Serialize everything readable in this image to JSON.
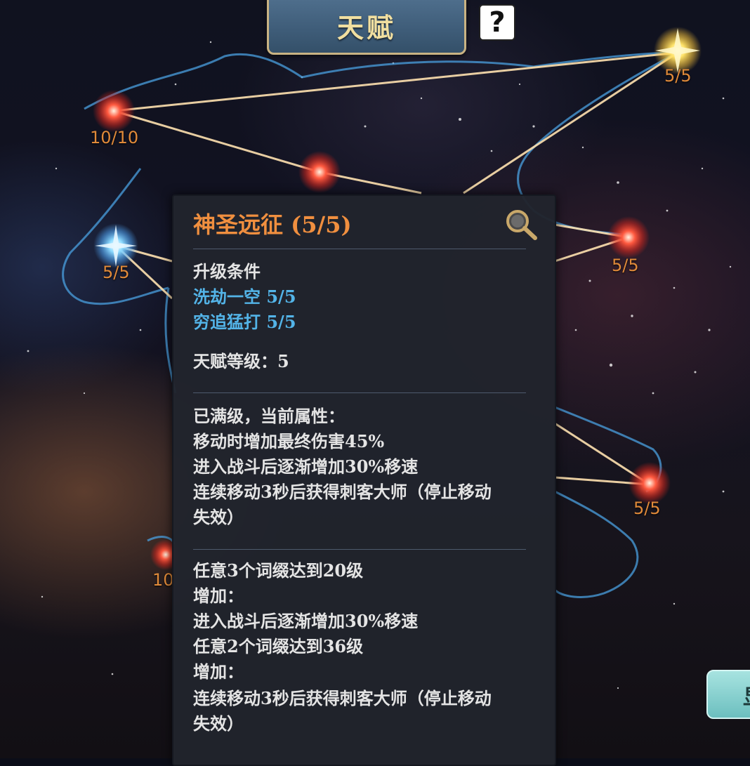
{
  "header": {
    "title": "天赋",
    "help_icon": "question-mark-icon"
  },
  "constellation": {
    "nodes": [
      {
        "id": "red-node-top-left",
        "label": "10/10",
        "color": "#ff4a3a"
      },
      {
        "id": "yellow-node-top-right",
        "label": "5/5",
        "color": "#ffd84a"
      },
      {
        "id": "red-node-upper-middle",
        "label": "",
        "color": "#ff4a3a"
      },
      {
        "id": "blue-node-left",
        "label": "5/5",
        "color": "#7fd0ff"
      },
      {
        "id": "red-node-right",
        "label": "5/5",
        "color": "#ff4a3a"
      },
      {
        "id": "red-node-lower-right",
        "label": "5/5",
        "color": "#ff4a3a"
      },
      {
        "id": "red-node-lower-left",
        "label": "10",
        "color": "#ff4a3a"
      }
    ]
  },
  "tooltip": {
    "title": "神圣远征 (5/5)",
    "search_icon": "magnifier-icon",
    "upgrade_header": "升级条件",
    "req_1": "洗劫一空 5/5",
    "req_2": "穷追猛打 5/5",
    "talent_level": "天赋等级：5",
    "current_header": "已满级，当前属性：",
    "attr_1": "移动时增加最终伤害45%",
    "attr_2": "进入战斗后逐渐增加30%移速",
    "attr_3a": "连续移动3秒后获得刺客大师（停止移动",
    "attr_3b": "失效）",
    "bonus_1": "任意3个词缀达到20级",
    "bonus_1_add": "增加：",
    "bonus_1_effect": "进入战斗后逐渐增加30%移速",
    "bonus_2": "任意2个词缀达到36级",
    "bonus_2_add": "增加：",
    "bonus_2_effect_a": "连续移动3秒后获得刺客大师（停止移动",
    "bonus_2_effect_b": "失效）"
  },
  "side_button": {
    "label": "显"
  },
  "colors": {
    "title_orange": "#f08f3f",
    "requirement_blue": "#53b4e8",
    "node_label_orange": "#e08a3a",
    "tab_gold": "#f1dfa0"
  }
}
